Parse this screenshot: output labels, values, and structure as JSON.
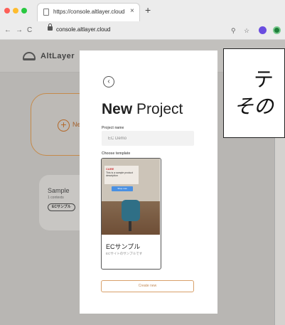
{
  "browser": {
    "tab_title": "https://console.altlayer.cloud",
    "tab_close": "×",
    "new_tab": "+",
    "nav_back": "←",
    "nav_forward": "→",
    "reload": "C",
    "address": "console.altlayer.cloud",
    "zoom_icon": "⚲",
    "star_icon": "☆"
  },
  "app": {
    "logo_text": "AltLayer",
    "new_card_label": "Ne",
    "sample": {
      "title": "Sample",
      "subtitle": "1 contexts",
      "tag": "ECサンプル"
    }
  },
  "modal": {
    "back_icon": "‹",
    "title_bold": "New",
    "title_rest": " Project",
    "project_name_label": "Project name",
    "project_name_value": "EC Demo",
    "template_label": "Choose template",
    "template": {
      "brand": "CARE",
      "sign_text": "This is a sample product description",
      "cta": "Shop now",
      "name": "ECサンプル",
      "description": "ECサイトのサンプルです"
    },
    "create_button": "Create new"
  },
  "callout": {
    "line1": "テ",
    "line2": "その"
  }
}
